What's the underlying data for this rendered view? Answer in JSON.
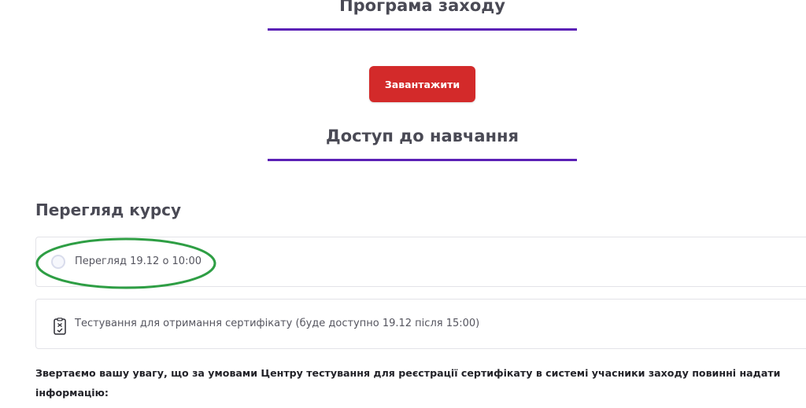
{
  "sections": {
    "program_title": "Програма заходу",
    "access_title": "Доступ до навчання"
  },
  "download_button": {
    "label": "Завантажити"
  },
  "course": {
    "heading": "Перегляд курсу",
    "items": [
      {
        "label": "Перегляд 19.12 о 10:00",
        "icon": "radio-circle-icon"
      },
      {
        "label": "Тестування для отримання сертифікату (буде доступно 19.12 після 15:00)",
        "icon": "test-checklist-icon"
      }
    ]
  },
  "notice": {
    "text": "Звертаємо вашу увагу, що за умовами Центру тестування для реєстрації сертифікату в системі учасники заходу повинні надати інформацію:"
  },
  "colors": {
    "accent_underline": "#5b21b6",
    "button_red": "#d32a2a",
    "highlight_green": "#2e9e44"
  }
}
